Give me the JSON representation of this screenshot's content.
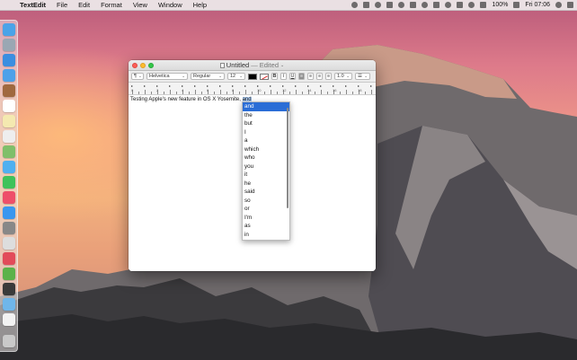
{
  "menubar": {
    "app_name": "TextEdit",
    "menus": [
      "File",
      "Edit",
      "Format",
      "View",
      "Window",
      "Help"
    ],
    "status": {
      "battery": "100%",
      "clock": "Fri 07:06"
    }
  },
  "window": {
    "title": "Untitled",
    "title_separator": "—",
    "edited": "Edited"
  },
  "toolbar": {
    "paragraph_style": "¶",
    "font_family": "Helvetica",
    "font_style": "Regular",
    "font_size": "12",
    "bold": "B",
    "italic": "I",
    "underline": "U",
    "line_spacing": "1.0"
  },
  "ruler": {
    "numbers": [
      "0",
      "2",
      "4",
      "6",
      "8",
      "10",
      "12",
      "14",
      "16",
      "18"
    ]
  },
  "document": {
    "text": "Testing Apple's new feature in OS X Yosemite, ",
    "selected_word": "and"
  },
  "completion": {
    "items": [
      "and",
      "the",
      "but",
      "I",
      "a",
      "which",
      "who",
      "you",
      "it",
      "he",
      "said",
      "so",
      "or",
      "I'm",
      "as",
      "in"
    ],
    "selected_index": 0
  },
  "colors": {
    "selection": "#2a6dd6",
    "highlight": "#b3d4fc"
  }
}
